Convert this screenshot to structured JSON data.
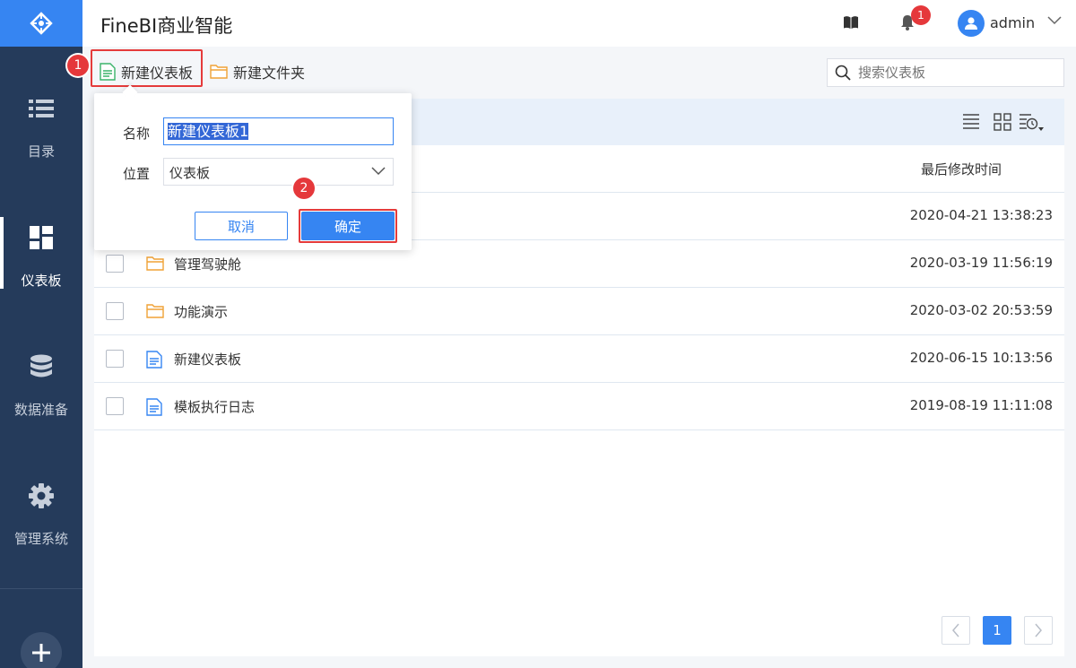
{
  "app": {
    "title": "FineBI商业智能"
  },
  "header": {
    "username": "admin",
    "notification_count": "1"
  },
  "sidebar": {
    "items": [
      {
        "label": "目录",
        "icon": "list-icon"
      },
      {
        "label": "仪表板",
        "icon": "dashboard-grid-icon",
        "active": true
      },
      {
        "label": "数据准备",
        "icon": "database-icon"
      },
      {
        "label": "管理系统",
        "icon": "gear-icon"
      }
    ]
  },
  "toolbar": {
    "new_dashboard": "新建仪表板",
    "new_folder": "新建文件夹",
    "search_placeholder": "搜索仪表板"
  },
  "steps": {
    "one": "1",
    "two": "2"
  },
  "dialog": {
    "name_label": "名称",
    "name_value": "新建仪表板1",
    "location_label": "位置",
    "location_value": "仪表板",
    "cancel": "取消",
    "ok": "确定"
  },
  "table": {
    "col_modified": "最后修改时间",
    "rows": [
      {
        "type": "folder",
        "name": "",
        "time": "2020-04-21 13:38:23"
      },
      {
        "type": "folder",
        "name": "管理驾驶舱",
        "time": "2020-03-19 11:56:19"
      },
      {
        "type": "folder",
        "name": "功能演示",
        "time": "2020-03-02 20:53:59"
      },
      {
        "type": "dashboard",
        "name": "新建仪表板",
        "time": "2020-06-15 10:13:56"
      },
      {
        "type": "dashboard",
        "name": "模板执行日志",
        "time": "2019-08-19 11:11:08"
      }
    ]
  },
  "pagination": {
    "current": "1"
  },
  "colors": {
    "accent": "#3685f2",
    "sidebar": "#253b5b",
    "highlight": "#e53b3b",
    "folder": "#f0a236"
  }
}
